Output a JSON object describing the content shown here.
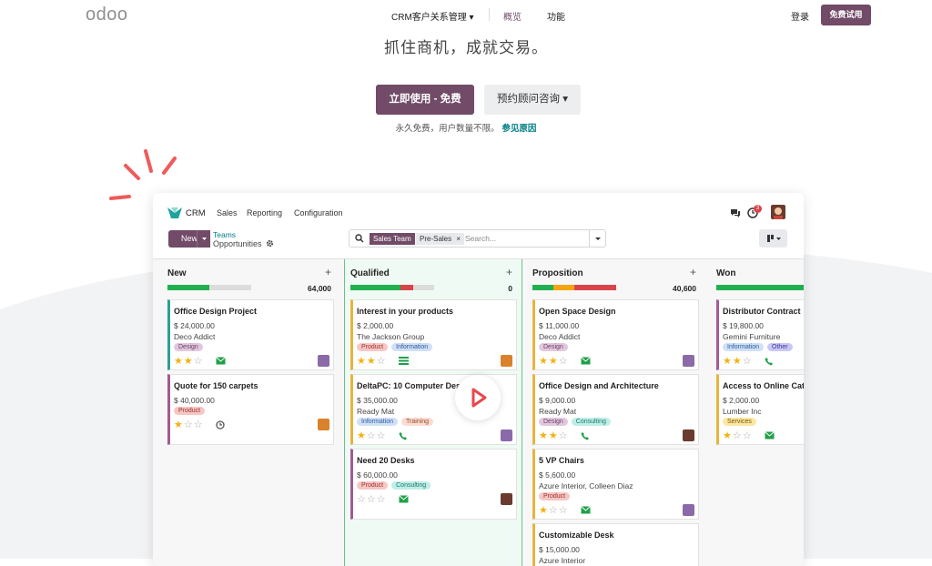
{
  "site": {
    "logo": "odoo",
    "nav": [
      {
        "label": "CRM客户关系管理 ▾"
      },
      {
        "label": "概览"
      },
      {
        "label": "功能"
      }
    ],
    "login": "登录",
    "try_free": "免费试用"
  },
  "hero": {
    "tagline": "抓住商机，成就交易。",
    "cta_primary": "立即使用 - 免费",
    "cta_secondary": "预约顾问咨询 ▾",
    "note_text": "永久免费，用户数量不限。",
    "note_link": "参见原因"
  },
  "app": {
    "name": "CRM",
    "menu": [
      "Sales",
      "Reporting",
      "Configuration"
    ],
    "activity_count": "3",
    "new_button": "New",
    "breadcrumb_parent": "Teams",
    "breadcrumb_current": "Opportunities",
    "search": {
      "facet_label": "Sales Team",
      "facet_value": "Pre-Sales",
      "facet_remove": "×",
      "placeholder": "Search..."
    },
    "columns": [
      {
        "name": "New",
        "total": "64,000",
        "progress": [
          {
            "color": "#21b050",
            "pct": 0.5
          }
        ],
        "cards": [
          {
            "title": "Office Design Project",
            "amount": "$ 24,000.00",
            "company": "Deco Addict",
            "tags": [
              {
                "label": "Design",
                "bg": "#e1c8de",
                "fg": "#6c3d67"
              }
            ],
            "stars": 2,
            "activity": "email-icon",
            "accent": "#2e9e96"
          },
          {
            "title": "Quote for 150 carpets",
            "amount": "$ 40,000.00",
            "company": "",
            "tags": [
              {
                "label": "Product",
                "bg": "#f6c7c5",
                "fg": "#9c2f2a"
              }
            ],
            "stars": 1,
            "activity": "clock-icon",
            "accent": "#a25a96"
          }
        ]
      },
      {
        "name": "Qualified",
        "total": "0",
        "progress": [
          {
            "color": "#21b050",
            "pct": 0.6
          },
          {
            "color": "#d9444b",
            "pct": 0.15
          }
        ],
        "cards": [
          {
            "title": "Interest in your products",
            "amount": "$ 2,000.00",
            "company": "The Jackson Group",
            "tags": [
              {
                "label": "Product",
                "bg": "#f6c7c5",
                "fg": "#9c2f2a"
              },
              {
                "label": "Information",
                "bg": "#cfe0f7",
                "fg": "#2d5a9a"
              }
            ],
            "stars": 2,
            "activity": "list-icon",
            "accent": "#e8b43e"
          },
          {
            "title": "DeltaPC: 10 Computer Desks",
            "amount": "$ 35,000.00",
            "company": "Ready Mat",
            "tags": [
              {
                "label": "Information",
                "bg": "#cfe0f7",
                "fg": "#2d5a9a"
              },
              {
                "label": "Training",
                "bg": "#fadcd2",
                "fg": "#9a4a2a"
              }
            ],
            "stars": 1,
            "activity": "phone-icon",
            "accent": "#e8b43e"
          },
          {
            "title": "Need 20 Desks",
            "amount": "$ 60,000.00",
            "company": "",
            "tags": [
              {
                "label": "Product",
                "bg": "#f6c7c5",
                "fg": "#9c2f2a"
              },
              {
                "label": "Consulting",
                "bg": "#bfeee7",
                "fg": "#1c7a6a"
              }
            ],
            "stars": 0,
            "activity": "email-icon",
            "accent": "#a25a96"
          }
        ]
      },
      {
        "name": "Proposition",
        "total": "40,600",
        "progress": [
          {
            "color": "#21b050",
            "pct": 0.25
          },
          {
            "color": "#f3a412",
            "pct": 0.25
          },
          {
            "color": "#d9444b",
            "pct": 0.5
          }
        ],
        "cards": [
          {
            "title": "Open Space Design",
            "amount": "$ 11,000.00",
            "company": "Deco Addict",
            "tags": [
              {
                "label": "Design",
                "bg": "#e1c8de",
                "fg": "#6c3d67"
              }
            ],
            "stars": 2,
            "activity": "email-icon",
            "accent": "#e8b43e"
          },
          {
            "title": "Office Design and Architecture",
            "amount": "$ 9,000.00",
            "company": "Ready Mat",
            "tags": [
              {
                "label": "Design",
                "bg": "#e1c8de",
                "fg": "#6c3d67"
              },
              {
                "label": "Consulting",
                "bg": "#bfeee7",
                "fg": "#1c7a6a"
              }
            ],
            "stars": 2,
            "activity": "phone-icon",
            "accent": "#e8b43e"
          },
          {
            "title": "5 VP Chairs",
            "amount": "$ 5,600.00",
            "company": "Azure Interior, Colleen Diaz",
            "tags": [
              {
                "label": "Product",
                "bg": "#f6c7c5",
                "fg": "#9c2f2a"
              }
            ],
            "stars": 1,
            "activity": "email-icon",
            "accent": "#e8b43e"
          },
          {
            "title": "Customizable Desk",
            "amount": "$ 15,000.00",
            "company": "Azure Interior",
            "tags": [],
            "stars": 0,
            "activity": "",
            "accent": "#e8b43e"
          }
        ]
      },
      {
        "name": "Won",
        "total": "",
        "progress": [
          {
            "color": "#21b050",
            "pct": 1.0
          }
        ],
        "cards": [
          {
            "title": "Distributor Contract",
            "amount": "$ 19,800.00",
            "company": "Gemini Furniture",
            "tags": [
              {
                "label": "Information",
                "bg": "#cfe0f7",
                "fg": "#2d5a9a"
              },
              {
                "label": "Other",
                "bg": "#c9c8f5",
                "fg": "#3a36a0"
              }
            ],
            "stars": 2,
            "activity": "phone-icon",
            "accent": "#a25a96"
          },
          {
            "title": "Access to Online Catalog",
            "amount": "$ 2,000.00",
            "company": "Lumber Inc",
            "tags": [
              {
                "label": "Services",
                "bg": "#fbe6a2",
                "fg": "#7a5a00"
              }
            ],
            "stars": 1,
            "activity": "email-icon",
            "accent": "#e8b43e"
          }
        ]
      }
    ]
  }
}
